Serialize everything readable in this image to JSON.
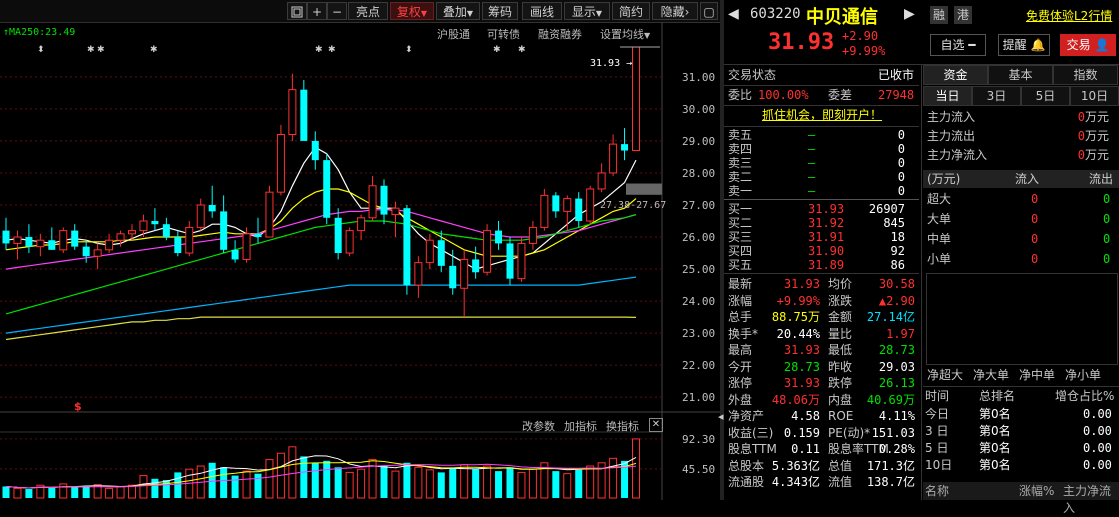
{
  "toolbar": {
    "icons": [
      "window-icon",
      "plus-icon",
      "minus-icon"
    ],
    "buttons": [
      "亮点",
      "复权",
      "叠加",
      "筹码",
      "画线",
      "显示",
      "简约",
      "隐藏"
    ],
    "active": "复权"
  },
  "overlay": {
    "ma_label": "MA250:23.49",
    "links": [
      "沪股通",
      "可转债",
      "融资融券",
      "设置均线"
    ],
    "price_tag": "31.93",
    "cross_label": "27.38-27.67",
    "indicator_tabs": [
      "改参数",
      "加指标",
      "换指标"
    ]
  },
  "chart_data": {
    "type": "candlestick",
    "price_axis": [
      "31.00",
      "30.00",
      "29.00",
      "28.00",
      "27.00",
      "26.00",
      "25.00",
      "24.00",
      "23.00",
      "22.00",
      "21.00"
    ],
    "ylim": [
      20.6,
      32.4
    ],
    "volume_axis": [
      "92.30",
      "45.50"
    ],
    "candles": [
      {
        "o": 26.2,
        "h": 26.6,
        "l": 25.6,
        "c": 25.8
      },
      {
        "o": 25.8,
        "h": 26.2,
        "l": 25.3,
        "c": 26.0
      },
      {
        "o": 26.0,
        "h": 26.4,
        "l": 25.5,
        "c": 25.7
      },
      {
        "o": 25.7,
        "h": 26.1,
        "l": 25.4,
        "c": 25.9
      },
      {
        "o": 25.9,
        "h": 26.3,
        "l": 25.6,
        "c": 25.6
      },
      {
        "o": 25.6,
        "h": 26.3,
        "l": 25.5,
        "c": 26.2
      },
      {
        "o": 26.2,
        "h": 26.4,
        "l": 25.6,
        "c": 25.7
      },
      {
        "o": 25.7,
        "h": 25.9,
        "l": 25.2,
        "c": 25.4
      },
      {
        "o": 25.4,
        "h": 25.8,
        "l": 25.0,
        "c": 25.6
      },
      {
        "o": 25.6,
        "h": 26.1,
        "l": 25.5,
        "c": 25.9
      },
      {
        "o": 25.9,
        "h": 26.2,
        "l": 25.7,
        "c": 26.1
      },
      {
        "o": 26.1,
        "h": 26.4,
        "l": 25.9,
        "c": 26.2
      },
      {
        "o": 26.2,
        "h": 26.7,
        "l": 26.0,
        "c": 26.5
      },
      {
        "o": 26.5,
        "h": 26.9,
        "l": 26.2,
        "c": 26.4
      },
      {
        "o": 26.4,
        "h": 26.6,
        "l": 25.9,
        "c": 26.0
      },
      {
        "o": 26.0,
        "h": 26.2,
        "l": 25.4,
        "c": 25.5
      },
      {
        "o": 25.5,
        "h": 26.5,
        "l": 25.4,
        "c": 26.3
      },
      {
        "o": 26.3,
        "h": 27.2,
        "l": 26.2,
        "c": 27.0
      },
      {
        "o": 27.0,
        "h": 27.6,
        "l": 26.6,
        "c": 26.8
      },
      {
        "o": 26.8,
        "h": 27.3,
        "l": 25.5,
        "c": 25.6
      },
      {
        "o": 25.6,
        "h": 25.9,
        "l": 25.2,
        "c": 25.3
      },
      {
        "o": 25.3,
        "h": 26.3,
        "l": 25.2,
        "c": 26.1
      },
      {
        "o": 26.1,
        "h": 26.6,
        "l": 25.8,
        "c": 26.0
      },
      {
        "o": 26.0,
        "h": 27.6,
        "l": 26.0,
        "c": 27.4
      },
      {
        "o": 27.4,
        "h": 29.5,
        "l": 27.3,
        "c": 29.2
      },
      {
        "o": 29.2,
        "h": 31.1,
        "l": 29.0,
        "c": 30.6
      },
      {
        "o": 30.6,
        "h": 30.9,
        "l": 29.6,
        "c": 29.0
      },
      {
        "o": 29.0,
        "h": 29.3,
        "l": 28.1,
        "c": 28.4
      },
      {
        "o": 28.4,
        "h": 28.6,
        "l": 26.4,
        "c": 26.6
      },
      {
        "o": 26.6,
        "h": 26.9,
        "l": 25.3,
        "c": 25.5
      },
      {
        "o": 25.5,
        "h": 26.3,
        "l": 25.4,
        "c": 26.2
      },
      {
        "o": 26.2,
        "h": 26.7,
        "l": 25.9,
        "c": 26.6
      },
      {
        "o": 26.6,
        "h": 27.9,
        "l": 26.5,
        "c": 27.6
      },
      {
        "o": 27.6,
        "h": 27.8,
        "l": 26.4,
        "c": 26.7
      },
      {
        "o": 26.7,
        "h": 27.1,
        "l": 26.0,
        "c": 26.9
      },
      {
        "o": 26.9,
        "h": 27.0,
        "l": 24.2,
        "c": 24.5
      },
      {
        "o": 24.5,
        "h": 25.4,
        "l": 24.1,
        "c": 25.2
      },
      {
        "o": 25.2,
        "h": 26.1,
        "l": 25.0,
        "c": 25.9
      },
      {
        "o": 25.9,
        "h": 26.2,
        "l": 24.9,
        "c": 25.1
      },
      {
        "o": 25.1,
        "h": 25.6,
        "l": 24.2,
        "c": 24.4
      },
      {
        "o": 24.4,
        "h": 25.6,
        "l": 23.5,
        "c": 25.3
      },
      {
        "o": 25.3,
        "h": 25.7,
        "l": 24.7,
        "c": 24.9
      },
      {
        "o": 24.9,
        "h": 26.4,
        "l": 24.8,
        "c": 26.2
      },
      {
        "o": 26.2,
        "h": 26.5,
        "l": 25.6,
        "c": 25.8
      },
      {
        "o": 25.8,
        "h": 26.0,
        "l": 24.5,
        "c": 24.7
      },
      {
        "o": 24.7,
        "h": 26.0,
        "l": 24.6,
        "c": 25.8
      },
      {
        "o": 25.8,
        "h": 26.5,
        "l": 25.6,
        "c": 26.3
      },
      {
        "o": 26.3,
        "h": 27.5,
        "l": 26.2,
        "c": 27.3
      },
      {
        "o": 27.3,
        "h": 27.4,
        "l": 26.6,
        "c": 26.8
      },
      {
        "o": 26.8,
        "h": 27.3,
        "l": 26.2,
        "c": 27.2
      },
      {
        "o": 27.2,
        "h": 27.4,
        "l": 26.3,
        "c": 26.5
      },
      {
        "o": 26.5,
        "h": 27.6,
        "l": 26.4,
        "c": 27.5
      },
      {
        "o": 27.5,
        "h": 28.3,
        "l": 27.4,
        "c": 28.0
      },
      {
        "o": 28.0,
        "h": 29.2,
        "l": 27.9,
        "c": 28.9
      },
      {
        "o": 28.9,
        "h": 29.4,
        "l": 28.4,
        "c": 28.7
      },
      {
        "o": 28.7,
        "h": 31.93,
        "l": 28.7,
        "c": 31.93
      }
    ],
    "volume": [
      18,
      15,
      14,
      20,
      16,
      22,
      17,
      19,
      21,
      15,
      18,
      20,
      35,
      30,
      28,
      40,
      45,
      50,
      55,
      48,
      35,
      42,
      38,
      60,
      70,
      80,
      65,
      55,
      58,
      48,
      40,
      45,
      60,
      50,
      42,
      55,
      48,
      44,
      40,
      46,
      52,
      45,
      50,
      42,
      48,
      40,
      45,
      55,
      42,
      38,
      44,
      50,
      55,
      62,
      58,
      92.3
    ],
    "ma": [
      {
        "color": "#ffffff",
        "values": [
          25.9,
          25.95,
          25.9,
          25.85,
          25.8,
          25.9,
          25.95,
          25.9,
          25.8,
          25.75,
          25.8,
          25.95,
          26.1,
          26.2,
          26.3,
          26.2,
          26.1,
          26.2,
          26.4,
          26.4,
          26.3,
          26.1,
          26.0,
          26.3,
          26.8,
          27.6,
          28.3,
          28.8,
          28.6,
          28.1,
          27.4,
          26.9,
          26.9,
          26.9,
          26.9,
          26.5,
          26.1,
          25.8,
          25.6,
          25.4,
          25.2,
          25.0,
          25.1,
          25.2,
          25.3,
          25.4,
          25.5,
          25.8,
          26.1,
          26.4,
          26.7,
          26.9,
          27.1,
          27.4,
          27.7,
          28.4
        ]
      },
      {
        "color": "#ffff00",
        "values": [
          25.6,
          25.65,
          25.7,
          25.75,
          25.75,
          25.8,
          25.85,
          25.85,
          25.85,
          25.85,
          25.9,
          25.9,
          25.95,
          26.0,
          26.0,
          26.0,
          26.0,
          26.05,
          26.1,
          26.15,
          26.1,
          26.1,
          26.1,
          26.25,
          26.5,
          26.9,
          27.2,
          27.4,
          27.5,
          27.5,
          27.4,
          27.2,
          27.0,
          26.9,
          26.8,
          26.6,
          26.4,
          26.2,
          26.0,
          25.8,
          25.6,
          25.5,
          25.4,
          25.4,
          25.4,
          25.4,
          25.5,
          25.6,
          25.8,
          26.0,
          26.2,
          26.4,
          26.6,
          26.8,
          26.9,
          27.2
        ]
      },
      {
        "color": "#ff40ff",
        "values": [
          25.0,
          25.05,
          25.1,
          25.15,
          25.2,
          25.25,
          25.3,
          25.35,
          25.4,
          25.45,
          25.5,
          25.55,
          25.6,
          25.65,
          25.7,
          25.75,
          25.8,
          25.85,
          25.9,
          25.95,
          26.0,
          26.05,
          26.1,
          26.2,
          26.3,
          26.4,
          26.5,
          26.6,
          26.7,
          26.75,
          26.8,
          26.8,
          26.85,
          26.85,
          26.85,
          26.8,
          26.7,
          26.6,
          26.5,
          26.4,
          26.3,
          26.2,
          26.1,
          26.05,
          26.0,
          26.0,
          26.0,
          26.05,
          26.1,
          26.15,
          26.2,
          26.3,
          26.4,
          26.5,
          26.6,
          26.7
        ]
      },
      {
        "color": "#00e000",
        "values": [
          23.6,
          23.7,
          23.8,
          23.9,
          24.0,
          24.1,
          24.2,
          24.3,
          24.4,
          24.5,
          24.6,
          24.7,
          24.8,
          24.9,
          25.0,
          25.1,
          25.2,
          25.3,
          25.4,
          25.5,
          25.6,
          25.7,
          25.8,
          25.9,
          26.0,
          26.1,
          26.2,
          26.3,
          26.35,
          26.4,
          26.45,
          26.5,
          26.5,
          26.5,
          26.45,
          26.4,
          26.3,
          26.2,
          26.1,
          26.05,
          26.0,
          25.95,
          25.9,
          25.9,
          25.9,
          25.9,
          25.95,
          26.0,
          26.1,
          26.2,
          26.3,
          26.4,
          26.5,
          26.55,
          26.6,
          26.7
        ]
      },
      {
        "color": "#00b4ff",
        "values": [
          23.0,
          23.05,
          23.1,
          23.15,
          23.2,
          23.25,
          23.3,
          23.35,
          23.4,
          23.45,
          23.5,
          23.55,
          23.6,
          23.65,
          23.7,
          23.75,
          23.8,
          23.85,
          23.9,
          23.95,
          24.0,
          24.05,
          24.1,
          24.15,
          24.2,
          24.25,
          24.3,
          24.35,
          24.4,
          24.45,
          24.5,
          24.5,
          24.5,
          24.5,
          24.5,
          24.5,
          24.5,
          24.5,
          24.5,
          24.5,
          24.5,
          24.5,
          24.5,
          24.5,
          24.5,
          24.5,
          24.5,
          24.5,
          24.5,
          24.5,
          24.5,
          24.55,
          24.6,
          24.65,
          24.7,
          24.75
        ]
      },
      {
        "color": "#e0e040",
        "values": [
          22.8,
          22.85,
          22.9,
          22.95,
          23.0,
          23.05,
          23.1,
          23.15,
          23.2,
          23.25,
          23.3,
          23.35,
          23.35,
          23.4,
          23.4,
          23.45,
          23.45,
          23.5,
          23.5,
          23.5,
          23.5,
          23.5,
          23.5,
          23.5,
          23.5,
          23.5,
          23.5,
          23.5,
          23.5,
          23.5,
          23.5,
          23.5,
          23.5,
          23.5,
          23.5,
          23.5,
          23.5,
          23.5,
          23.5,
          23.5,
          23.5,
          23.5,
          23.5,
          23.5,
          23.5,
          23.5,
          23.5,
          23.5,
          23.5,
          23.5,
          23.5,
          23.5,
          23.5,
          23.5,
          23.5,
          23.49
        ]
      }
    ]
  },
  "quote": {
    "code": "603220",
    "name": "中贝通信",
    "badges": [
      "融",
      "港"
    ],
    "promo_link": "免费体验L2行情",
    "price": "31.93",
    "change": "+2.90",
    "change_pct": "+9.99%",
    "select_btn": "自选",
    "alert_btn": "提醒",
    "trade_btn": "交易",
    "status_label": "交易状态",
    "status_value": "已收市",
    "ratio_label": "委比",
    "ratio_value": "100.00%",
    "diff_label": "委差",
    "diff_value": "27948",
    "banner": "抓住机会，即刻开户！"
  },
  "orderbook": {
    "asks": [
      {
        "label": "卖五",
        "price": "—",
        "vol": "0"
      },
      {
        "label": "卖四",
        "price": "—",
        "vol": "0"
      },
      {
        "label": "卖三",
        "price": "—",
        "vol": "0"
      },
      {
        "label": "卖二",
        "price": "—",
        "vol": "0"
      },
      {
        "label": "卖一",
        "price": "—",
        "vol": "0"
      }
    ],
    "bids": [
      {
        "label": "买一",
        "price": "31.93",
        "vol": "26907"
      },
      {
        "label": "买二",
        "price": "31.92",
        "vol": "845"
      },
      {
        "label": "买三",
        "price": "31.91",
        "vol": "18"
      },
      {
        "label": "买四",
        "price": "31.90",
        "vol": "92"
      },
      {
        "label": "买五",
        "price": "31.89",
        "vol": "86"
      }
    ]
  },
  "stats": [
    {
      "l1": "最新",
      "v1": "31.93",
      "c1": "red",
      "l2": "均价",
      "v2": "30.58",
      "c2": "red"
    },
    {
      "l1": "涨幅",
      "v1": "+9.99%",
      "c1": "red",
      "l2": "涨跌",
      "v2": "▲2.90",
      "c2": "red"
    },
    {
      "l1": "总手",
      "v1": "88.75万",
      "c1": "yellow",
      "l2": "金额",
      "v2": "27.14亿",
      "c2": "cyan"
    },
    {
      "l1": "换手*",
      "v1": "20.44%",
      "c1": "white",
      "l2": "量比",
      "v2": "1.97",
      "c2": "red"
    },
    {
      "l1": "最高",
      "v1": "31.93",
      "c1": "red",
      "l2": "最低",
      "v2": "28.73",
      "c2": "green"
    },
    {
      "l1": "今开",
      "v1": "28.73",
      "c1": "green",
      "l2": "昨收",
      "v2": "29.03",
      "c2": "white"
    },
    {
      "l1": "涨停",
      "v1": "31.93",
      "c1": "red",
      "l2": "跌停",
      "v2": "26.13",
      "c2": "green"
    },
    {
      "l1": "外盘",
      "v1": "48.06万",
      "c1": "red",
      "l2": "内盘",
      "v2": "40.69万",
      "c2": "green"
    },
    {
      "l1": "净资产",
      "v1": "4.58",
      "c1": "white",
      "l2": "ROE",
      "v2": "4.11%",
      "c2": "white"
    },
    {
      "l1": "收益(三)",
      "v1": "0.159",
      "c1": "white",
      "l2": "PE(动)*",
      "v2": "151.03",
      "c2": "white"
    },
    {
      "l1": "股息TTM",
      "v1": "0.11",
      "c1": "white",
      "l2": "股息率TTM",
      "v2": "0.28%",
      "c2": "white"
    },
    {
      "l1": "总股本",
      "v1": "5.363亿",
      "c1": "white",
      "l2": "总值",
      "v2": "171.3亿",
      "c2": "white"
    },
    {
      "l1": "流通股",
      "v1": "4.343亿",
      "c1": "white",
      "l2": "流值",
      "v2": "138.7亿",
      "c2": "white"
    }
  ],
  "funds": {
    "tabs": [
      "资金",
      "基本",
      "指数"
    ],
    "periods": [
      "当日",
      "3日",
      "5日",
      "10日"
    ],
    "flows": [
      {
        "label": "主力流入",
        "value": "0",
        "unit": "万元"
      },
      {
        "label": "主力流出",
        "value": "0",
        "unit": "万元"
      },
      {
        "label": "主力净流入",
        "value": "0",
        "unit": "万元"
      }
    ],
    "table_head": [
      "(万元)",
      "流入",
      "流出"
    ],
    "table_rows": [
      {
        "label": "超大",
        "in": "0",
        "out": "0"
      },
      {
        "label": "大单",
        "in": "0",
        "out": "0"
      },
      {
        "label": "中单",
        "in": "0",
        "out": "0"
      },
      {
        "label": "小单",
        "in": "0",
        "out": "0"
      }
    ],
    "net_tabs": [
      "净超大",
      "净大单",
      "净中单",
      "净小单"
    ],
    "rank_head": [
      "时间",
      "总排名",
      "增仓占比%"
    ],
    "rank_rows": [
      {
        "t": "今日",
        "r": "第0名",
        "p": "0.00"
      },
      {
        "t": "3 日",
        "r": "第0名",
        "p": "0.00"
      },
      {
        "t": "5 日",
        "r": "第0名",
        "p": "0.00"
      },
      {
        "t": "10日",
        "r": "第0名",
        "p": "0.00"
      }
    ],
    "footer": [
      "名称",
      "涨幅%",
      "主力净流入"
    ]
  }
}
